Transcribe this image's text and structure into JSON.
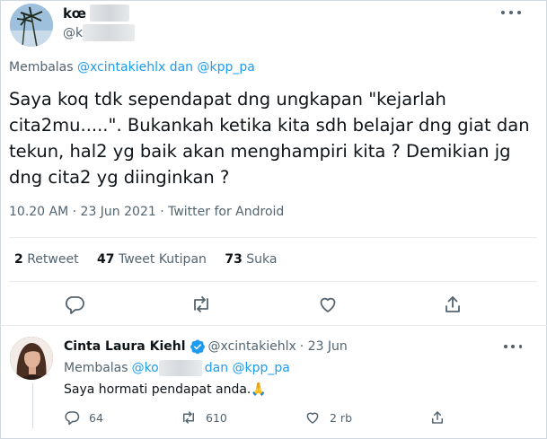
{
  "main_tweet": {
    "name": "kœ",
    "handle": "@k",
    "reply_prefix": "Membalas",
    "reply_mentions": "@xcintakiehlx dan @kpp_pa",
    "text": "Saya koq tdk sependapat dng ungkapan \"kejarlah cita2mu.....\". Bukankah ketika kita sdh belajar dng giat dan tekun, hal2 yg baik akan menghampiri kita ? Demikian jg dng cita2 yg diinginkan ?",
    "meta": "10.20 AM · 23 Jun 2021 · Twitter for Android",
    "stats": {
      "retweets_count": "2",
      "retweets_label": "Retweet",
      "quotes_count": "47",
      "quotes_label": "Tweet Kutipan",
      "likes_count": "73",
      "likes_label": "Suka"
    },
    "icons": [
      "more-icon",
      "reply-icon",
      "retweet-icon",
      "like-icon",
      "share-icon"
    ]
  },
  "reply_tweet": {
    "name": "Cinta Laura Kiehl",
    "handle": "@xcintakiehlx",
    "time": "· 23 Jun",
    "reply_prefix": "Membalas",
    "reply_mention_start": "@ko",
    "reply_mention_rest": "dan @kpp_pa",
    "text": "Saya hormati pendapat anda.🙏",
    "replies": "64",
    "retweets": "610",
    "likes": "2 rb"
  },
  "colors": {
    "accent": "#1d9bf0",
    "secondary_text": "#536471",
    "primary_text": "#0f1419",
    "divider": "#e6e9eb"
  }
}
